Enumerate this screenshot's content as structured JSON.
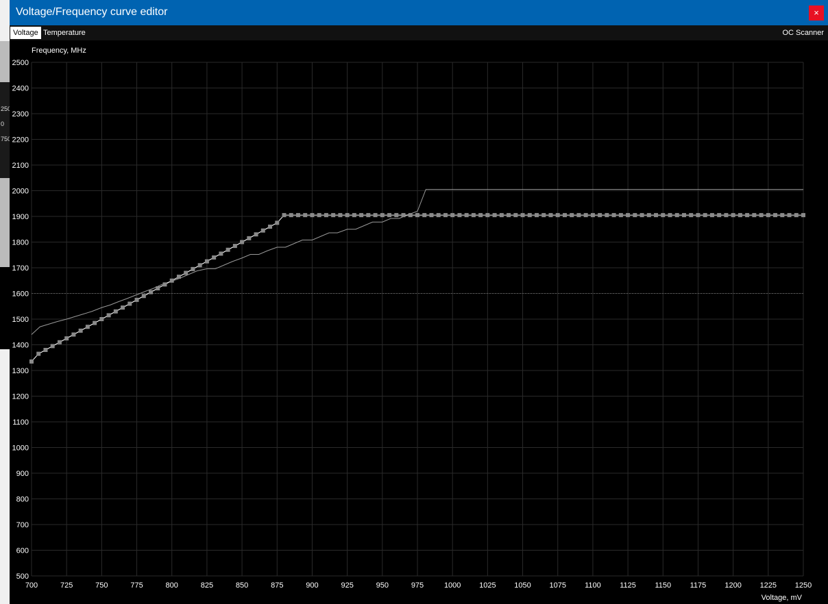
{
  "window": {
    "title": "Voltage/Frequency curve editor",
    "close_label": "×"
  },
  "tabs": [
    {
      "label": "Voltage",
      "active": true
    },
    {
      "label": "Temperature",
      "active": false
    }
  ],
  "oc_scanner_label": "OC Scanner",
  "background_dial_labels": [
    "250",
    "0",
    "750"
  ],
  "chart_data": {
    "type": "line",
    "ylabel": "Frequency, MHz",
    "xlabel": "Voltage, mV",
    "xlim": [
      700,
      1250
    ],
    "ylim": [
      500,
      2500
    ],
    "xticks": [
      700,
      725,
      750,
      775,
      800,
      825,
      850,
      875,
      900,
      925,
      950,
      975,
      1000,
      1025,
      1050,
      1075,
      1100,
      1125,
      1150,
      1175,
      1200,
      1225,
      1250
    ],
    "yticks": [
      500,
      600,
      700,
      800,
      900,
      1000,
      1100,
      1200,
      1300,
      1400,
      1500,
      1600,
      1700,
      1800,
      1900,
      2000,
      2100,
      2200,
      2300,
      2400,
      2500
    ],
    "reference_line": 1600,
    "grid": true,
    "series": [
      {
        "role": "default-curve",
        "color": "#9a9a9a",
        "x": [
          700,
          706,
          712,
          718,
          725,
          731,
          737,
          743,
          750,
          756,
          762,
          768,
          775,
          781,
          787,
          793,
          800,
          806,
          812,
          818,
          825,
          831,
          837,
          843,
          850,
          856,
          862,
          868,
          875,
          881,
          887,
          893,
          900,
          906,
          912,
          918,
          925,
          931,
          937,
          943,
          950,
          956,
          962,
          968,
          975,
          981,
          1250
        ],
        "y": [
          1440,
          1470,
          1480,
          1490,
          1500,
          1510,
          1520,
          1530,
          1545,
          1555,
          1568,
          1580,
          1595,
          1608,
          1620,
          1635,
          1648,
          1660,
          1674,
          1688,
          1696,
          1696,
          1710,
          1724,
          1738,
          1752,
          1752,
          1766,
          1780,
          1780,
          1794,
          1808,
          1808,
          1822,
          1836,
          1836,
          1850,
          1850,
          1864,
          1878,
          1878,
          1892,
          1892,
          1906,
          1920,
          2005,
          2005
        ]
      },
      {
        "role": "current-curve",
        "color": "#ffffff",
        "x": [
          700,
          705,
          710,
          715,
          720,
          725,
          730,
          735,
          740,
          745,
          750,
          755,
          760,
          765,
          770,
          775,
          780,
          785,
          790,
          795,
          800,
          805,
          810,
          815,
          820,
          825,
          830,
          835,
          840,
          845,
          850,
          855,
          860,
          865,
          870,
          875,
          880,
          885,
          890,
          895,
          900,
          905,
          910,
          915,
          920,
          925,
          930,
          935,
          940,
          945,
          950,
          955,
          960,
          965,
          970,
          975,
          980,
          985,
          990,
          995,
          1000,
          1005,
          1010,
          1015,
          1020,
          1025,
          1030,
          1035,
          1040,
          1045,
          1050,
          1055,
          1060,
          1065,
          1070,
          1075,
          1080,
          1085,
          1090,
          1095,
          1100,
          1105,
          1110,
          1115,
          1120,
          1125,
          1130,
          1135,
          1140,
          1145,
          1150,
          1155,
          1160,
          1165,
          1170,
          1175,
          1180,
          1185,
          1190,
          1195,
          1200,
          1205,
          1210,
          1215,
          1220,
          1225,
          1230,
          1235,
          1240,
          1245,
          1250
        ],
        "y": [
          1335,
          1365,
          1380,
          1395,
          1410,
          1425,
          1440,
          1455,
          1470,
          1485,
          1500,
          1515,
          1530,
          1545,
          1560,
          1575,
          1590,
          1605,
          1620,
          1635,
          1650,
          1665,
          1680,
          1695,
          1710,
          1725,
          1740,
          1755,
          1770,
          1785,
          1800,
          1815,
          1830,
          1845,
          1860,
          1875,
          1905,
          1905,
          1905,
          1905,
          1905,
          1905,
          1905,
          1905,
          1905,
          1905,
          1905,
          1905,
          1905,
          1905,
          1905,
          1905,
          1905,
          1905,
          1905,
          1905,
          1905,
          1905,
          1905,
          1905,
          1905,
          1905,
          1905,
          1905,
          1905,
          1905,
          1905,
          1905,
          1905,
          1905,
          1905,
          1905,
          1905,
          1905,
          1905,
          1905,
          1905,
          1905,
          1905,
          1905,
          1905,
          1905,
          1905,
          1905,
          1905,
          1905,
          1905,
          1905,
          1905,
          1905,
          1905,
          1905,
          1905,
          1905,
          1905,
          1905,
          1905,
          1905,
          1905,
          1905,
          1905,
          1905,
          1905,
          1905,
          1905,
          1905,
          1905,
          1905,
          1905,
          1905,
          1905
        ]
      }
    ]
  }
}
